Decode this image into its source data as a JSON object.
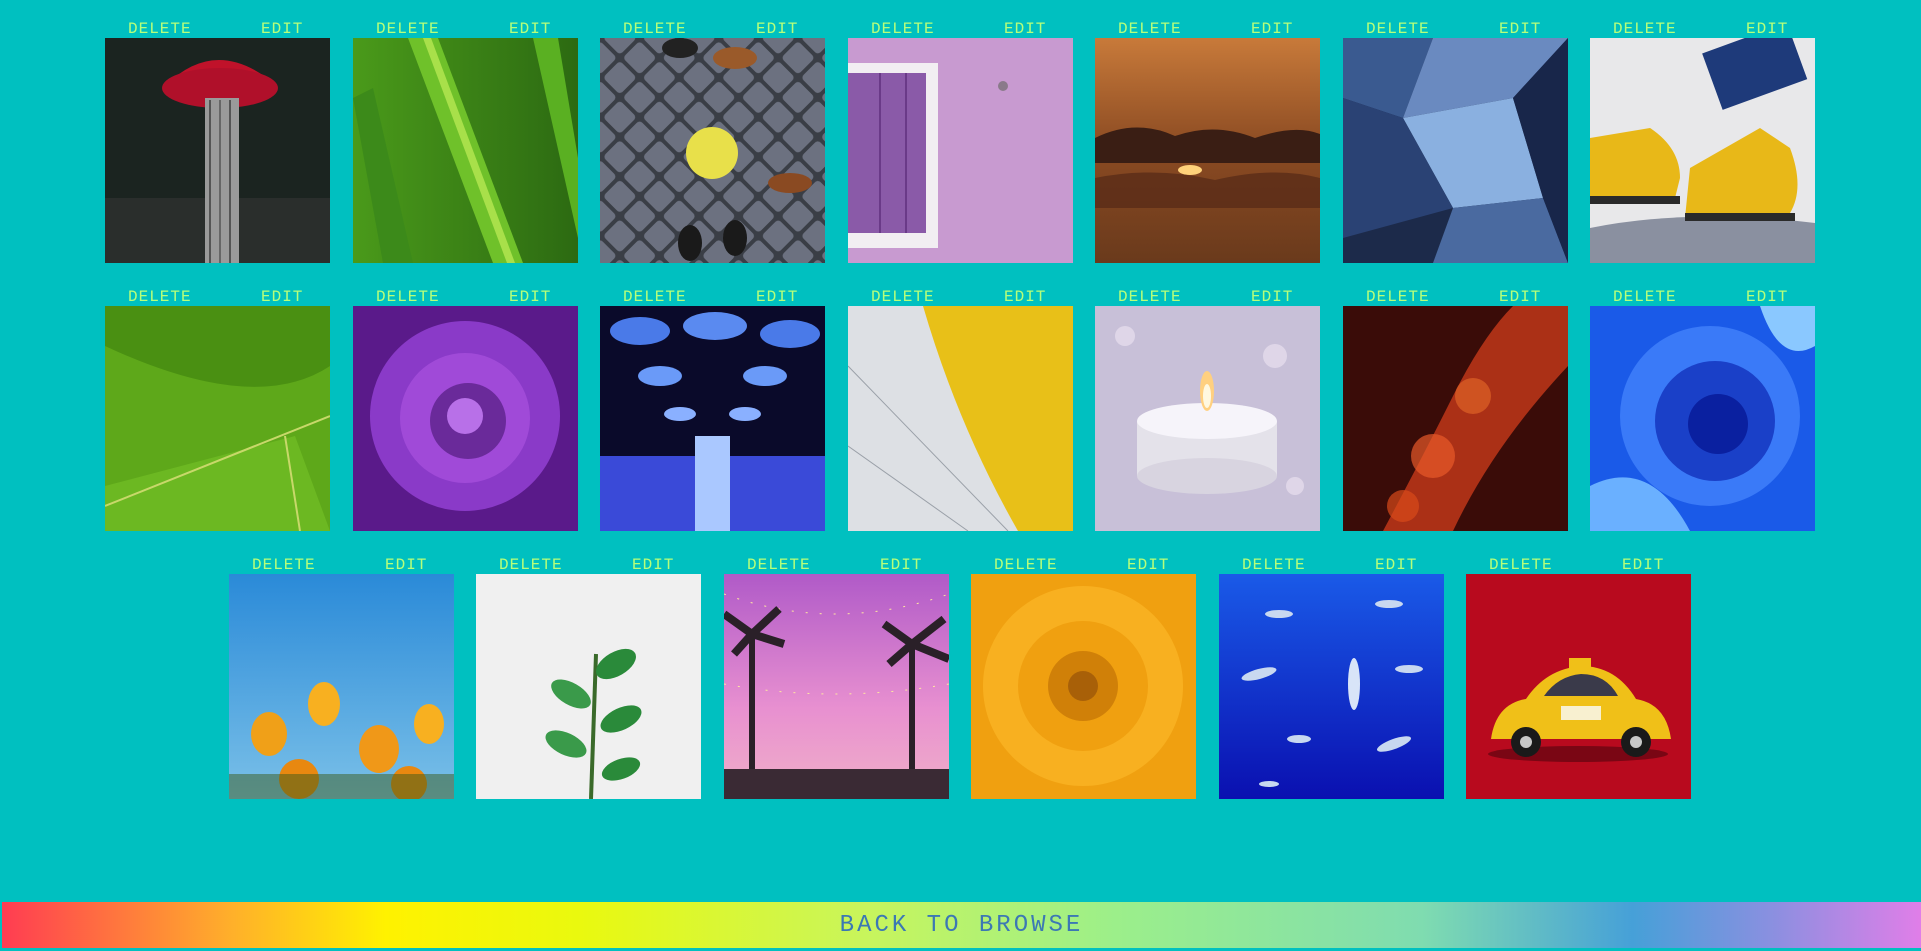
{
  "actions": {
    "delete_label": "DELETE",
    "edit_label": "EDIT"
  },
  "footer": {
    "back_label": "BACK TO BROWSE"
  },
  "colors": {
    "background": "#00c0c0",
    "action_text": "#b6ff7a",
    "back_text": "#3c78b4"
  },
  "photos": [
    {
      "subject": "red umbrella in rain"
    },
    {
      "subject": "green grass blades"
    },
    {
      "subject": "cobblestone street with shoes"
    },
    {
      "subject": "lavender wall with window"
    },
    {
      "subject": "sunset over clouds"
    },
    {
      "subject": "blue glass geometric facade"
    },
    {
      "subject": "yellow boots on rock"
    },
    {
      "subject": "green leaf close-up"
    },
    {
      "subject": "purple peony flower"
    },
    {
      "subject": "blue umbrellas at night"
    },
    {
      "subject": "yellow and white abstract"
    },
    {
      "subject": "candle with bokeh"
    },
    {
      "subject": "red light bokeh"
    },
    {
      "subject": "blue paint swirl"
    },
    {
      "subject": "orange poppies"
    },
    {
      "subject": "green plant on white"
    },
    {
      "subject": "palm trees at pink dusk"
    },
    {
      "subject": "orange flower close-up"
    },
    {
      "subject": "sharks in blue ocean"
    },
    {
      "subject": "yellow toy taxi on red"
    }
  ]
}
